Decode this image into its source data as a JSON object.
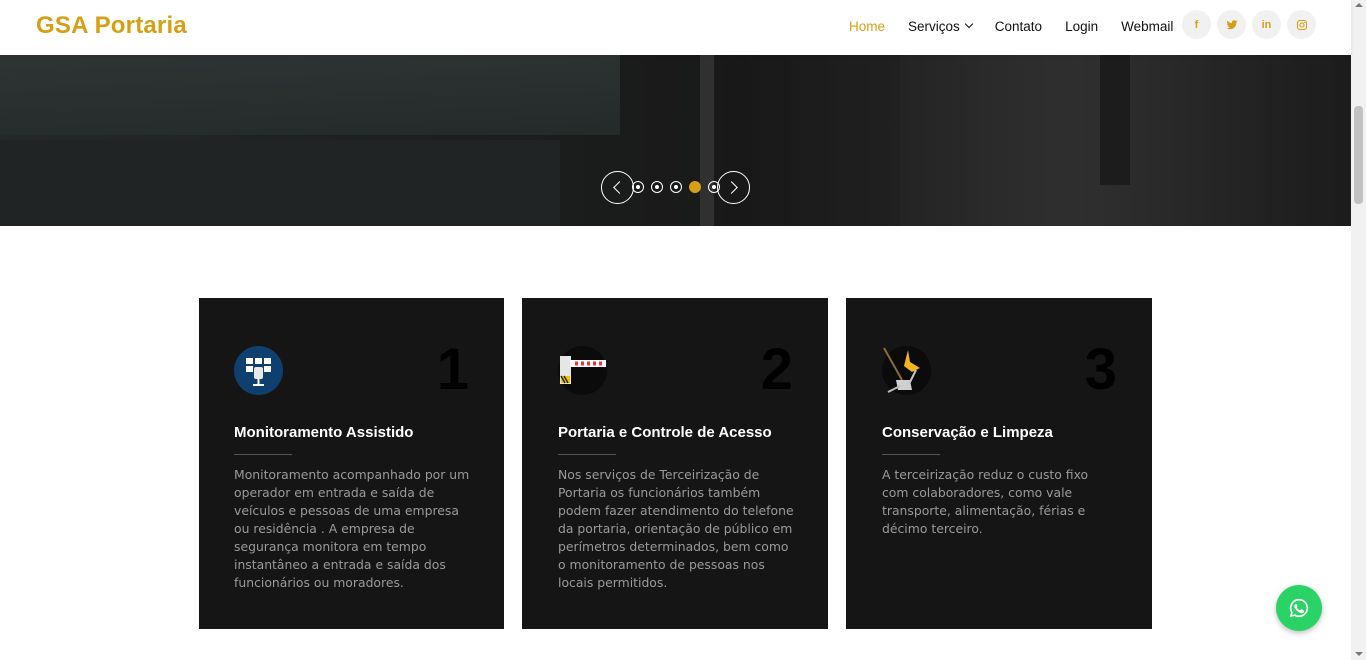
{
  "brand": {
    "name": "GSA Portaria",
    "accent": "#d4a017"
  },
  "nav": {
    "items": [
      {
        "label": "Home",
        "active": true
      },
      {
        "label": "Serviços",
        "dropdown": true
      },
      {
        "label": "Contato"
      },
      {
        "label": "Login"
      },
      {
        "label": "Webmail"
      }
    ]
  },
  "social": [
    {
      "icon": "facebook-icon",
      "glyph": "f"
    },
    {
      "icon": "twitter-icon"
    },
    {
      "icon": "linkedin-icon",
      "glyph": "in"
    },
    {
      "icon": "instagram-icon"
    }
  ],
  "slider": {
    "slide_count": 5,
    "active_index": 3
  },
  "cards": [
    {
      "number": "1",
      "icon": "monitoring-icon",
      "title": "Monitoramento Assistido",
      "description": "Monitoramento acompanhado por um operador em entrada e saída de veículos e pessoas de uma empresa ou residência . A empresa de segurança monitora em tempo instantâneo a entrada e saída dos funcionários ou moradores."
    },
    {
      "number": "2",
      "icon": "barrier-gate-icon",
      "title": "Portaria e Controle de Acesso",
      "description": "Nos serviços de Terceirização de Portaria os funcionários também podem fazer atendimento do telefone da portaria, orientação de público em perímetros determinados, bem como o monitoramento de pessoas nos locais permitidos."
    },
    {
      "number": "3",
      "icon": "cleaning-icon",
      "title": "Conservação e Limpeza",
      "description": "A terceirização reduz o custo fixo com colaboradores, como vale transporte, alimentação, férias e décimo terceiro."
    }
  ],
  "whatsapp": {
    "icon": "whatsapp-icon",
    "color": "#2bd366"
  }
}
